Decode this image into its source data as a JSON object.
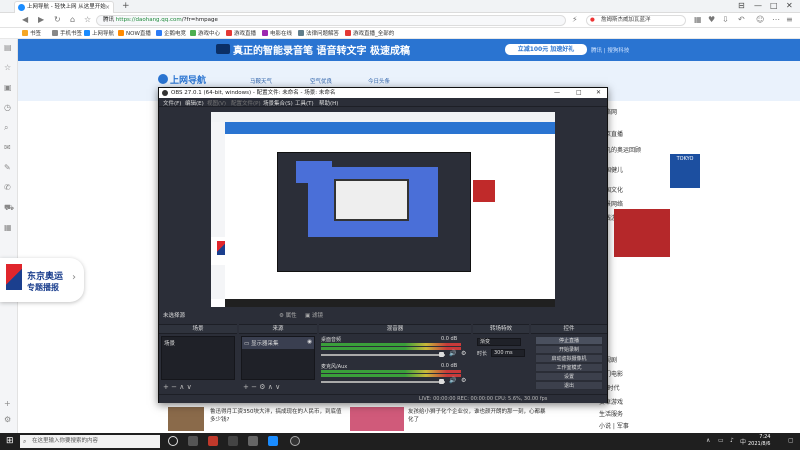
{
  "browser": {
    "tab_title": "上网导航 - 轻快上网 从这里开始",
    "tab_close": "×",
    "new_tab": "+",
    "window_controls": [
      "⊟",
      "—",
      "□",
      "✕"
    ],
    "url_prefix": "腾讯",
    "url_host": "https://daohang.qq.com",
    "url_path": "/?fr=hmpage",
    "search_text": "詹姆斯杰威加瓦蓝洋",
    "bookmarks": [
      "书签",
      "手机书签",
      "上网导航",
      "NOW直播",
      "企鹅电竞",
      "游戏中心",
      "游戏直播",
      "电影在线",
      "法律问题解答",
      "游戏直播_全部的"
    ]
  },
  "page": {
    "banner_text": "真正的智能录音笔  语音转文字 极速成稿",
    "banner_button": "立减100元 加速好礼",
    "banner_brand": "腾讯 | 搜狗科技",
    "header_logo": "上网导航",
    "header_links": [
      "马鞍天气",
      "空气优良",
      "今日头条"
    ],
    "right_col": [
      "网络网",
      "东京直播",
      "平凡的奥运回顾",
      "中国健儿",
      "美国文化",
      "实景网络",
      "在线游戏",
      "电视剧",
      "热门电影",
      "5G时代",
      "安卓游戏",
      "生活服务",
      "小说 | 军事",
      "游戏 | 动漫"
    ],
    "promo_title": "东京奥运",
    "promo_sub": "专题播报",
    "promo_chevron": "›",
    "news1": "鲁迅得月工资350块大洋，搞成现在的人民币，到底值多少钱?",
    "news2": "友孩给小狮子化个企业仪，谁也颜开朗的那一刻，心都暴化了"
  },
  "obs": {
    "title": "OBS 27.0.1 (64-bit, windows) - 配置文件: 未命名 - 场景: 未命名",
    "window_controls": [
      "—",
      "□",
      "✕"
    ],
    "menu": [
      "文件(F)",
      "编辑(E)",
      "视图(V)",
      "配置文件(P)",
      "场景集合(S)",
      "工具(T)",
      "帮助(H)"
    ],
    "no_source": "未选择源",
    "prop_btn": "⚙ 属性",
    "filter_btn": "▣ 滤镜",
    "docks": {
      "scenes": "场景",
      "sources": "来源",
      "mixer": "混音器",
      "transitions": "转场特效",
      "controls": "控件"
    },
    "scene_item": "场景",
    "source_item": "显示器采集",
    "mixer": [
      {
        "name": "桌面音频",
        "db": "0.0 dB"
      },
      {
        "name": "麦克风/Aux",
        "db": "0.0 dB"
      }
    ],
    "transition": "渐变",
    "duration_label": "时长",
    "duration_value": "300 ms",
    "controls": [
      "停止直播",
      "开始录制",
      "启动虚拟摄像机",
      "工作室模式",
      "设置",
      "退出"
    ],
    "status": "LIVE: 00:00:00    REC: 00:00:00    CPU: 5.6%, 30.00 fps"
  },
  "taskbar": {
    "start": "⊞",
    "search_placeholder": "在这里输入你要搜索的内容",
    "time": "7:24",
    "date": "2021/8/6",
    "lang": "中"
  }
}
